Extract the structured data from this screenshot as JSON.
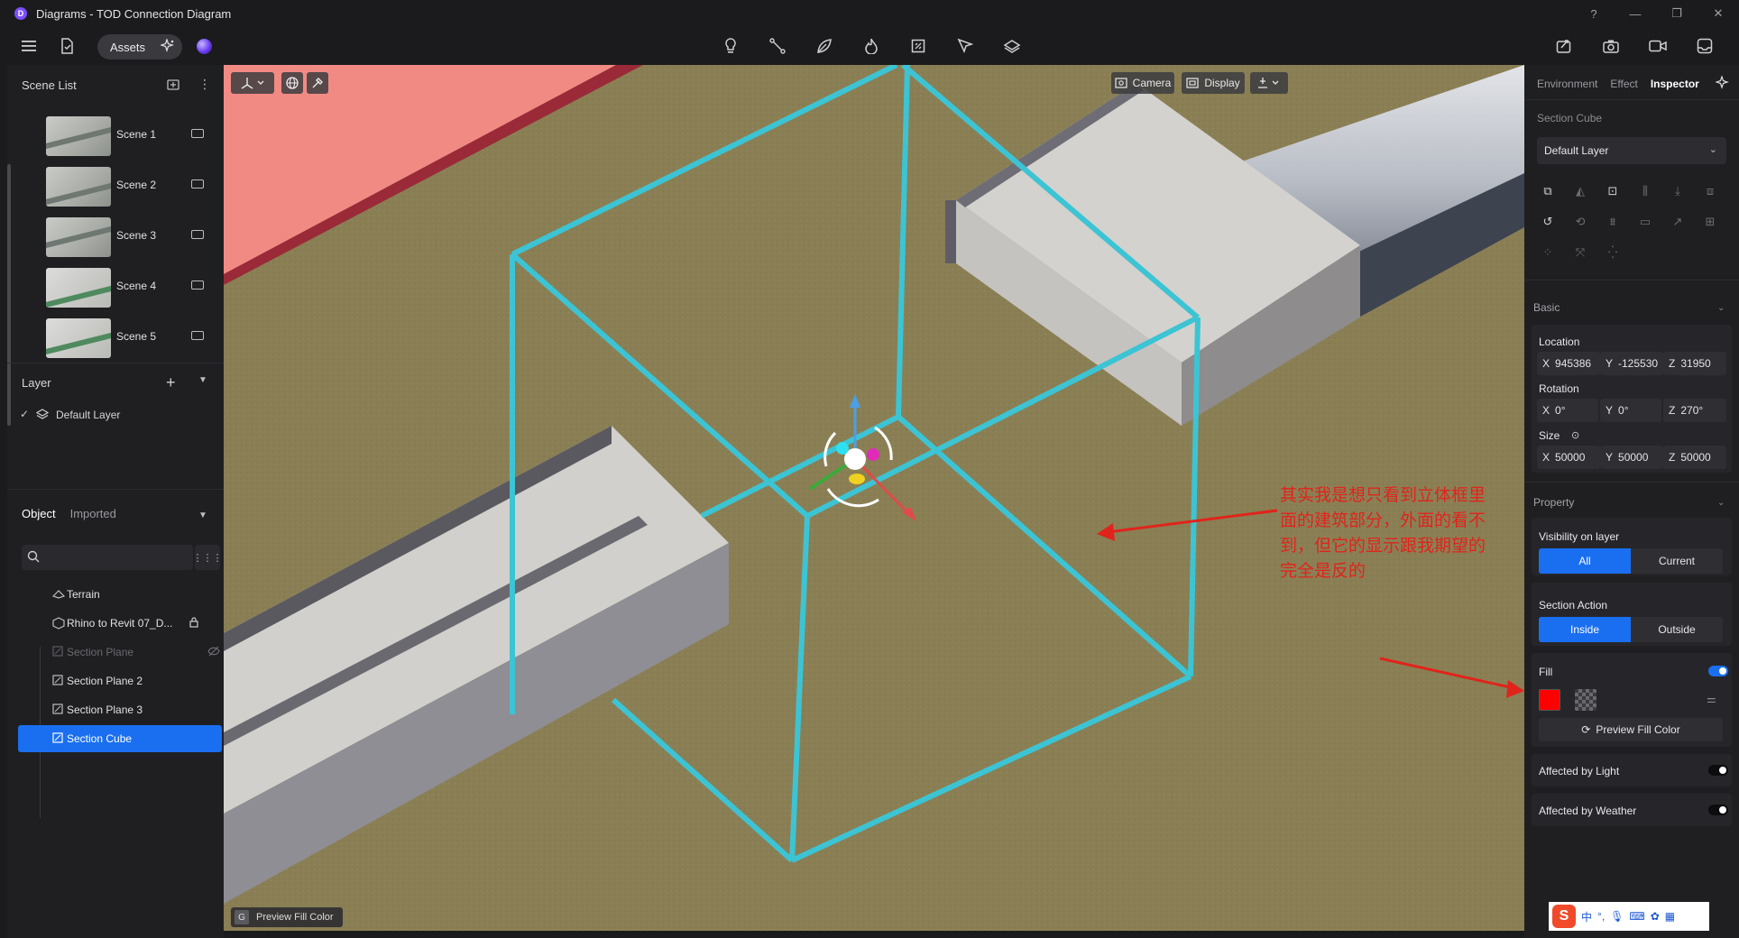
{
  "window": {
    "title": "Diagrams - TOD Connection Diagram",
    "controls": [
      "?",
      "—",
      "❐",
      "✕"
    ]
  },
  "toolbar": {
    "assets_label": "Assets",
    "center_tools": [
      "lightbulb-icon",
      "path-icon",
      "leaf-icon",
      "flame-icon",
      "section-icon",
      "pin-icon",
      "layers-icon"
    ],
    "right_tools": [
      "export-icon",
      "camera-icon",
      "video-icon",
      "inbox-icon"
    ]
  },
  "left": {
    "scene_list_title": "Scene List",
    "scenes": [
      {
        "name": "Scene 1"
      },
      {
        "name": "Scene 2"
      },
      {
        "name": "Scene 3"
      },
      {
        "name": "Scene 4"
      },
      {
        "name": "Scene 5"
      }
    ],
    "layer_title": "Layer",
    "layer_item": "Default Layer",
    "object_tab": "Object",
    "imported_tab": "Imported",
    "search_placeholder": "",
    "tree": [
      {
        "label": "Terrain",
        "icon": "terrain-icon",
        "state": "normal"
      },
      {
        "label": "Rhino to Revit 07_D...",
        "icon": "model-icon",
        "state": "locked"
      },
      {
        "label": "Section Plane",
        "icon": "section-plane-icon",
        "state": "hidden"
      },
      {
        "label": "Section Plane 2",
        "icon": "section-plane-icon",
        "state": "normal"
      },
      {
        "label": "Section Plane 3",
        "icon": "section-plane-icon",
        "state": "normal"
      },
      {
        "label": "Section Cube",
        "icon": "section-cube-icon",
        "state": "selected"
      }
    ]
  },
  "viewport": {
    "camera_label": "Camera",
    "display_label": "Display",
    "annotation": "其实我是想只看到立体框里面的建筑部分，外面的看不到，但它的显示跟我期望的完全是反的",
    "preview_key": "G",
    "preview_label": "Preview Fill Color",
    "colors": {
      "ground": "#8a7f54",
      "cube": "#3cc4d4",
      "arrow": "#e0241b",
      "red_zone": "#f28a84"
    }
  },
  "right": {
    "tabs": [
      "Environment",
      "Effect",
      "Inspector"
    ],
    "active_tab": "Inspector",
    "object_type": "Section Cube",
    "layer_dropdown": "Default Layer",
    "basic_title": "Basic",
    "location_label": "Location",
    "location": {
      "x": "945386",
      "y": "-125530",
      "z": "31950"
    },
    "rotation_label": "Rotation",
    "rotation": {
      "x": "0°",
      "y": "0°",
      "z": "270°"
    },
    "size_label": "Size",
    "size": {
      "x": "50000",
      "y": "50000",
      "z": "50000"
    },
    "property_title": "Property",
    "visibility_label": "Visibility on layer",
    "visibility_options": [
      "All",
      "Current"
    ],
    "visibility_selected": "All",
    "section_action_label": "Section Action",
    "section_action_options": [
      "Inside",
      "Outside"
    ],
    "section_action_selected": "Inside",
    "fill_label": "Fill",
    "fill_on": true,
    "fill_color": "#ff0000",
    "preview_fill_button": "Preview Fill Color",
    "affected_light_label": "Affected by Light",
    "affected_light_on": false,
    "affected_weather_label": "Affected by Weather",
    "affected_weather_on": false
  },
  "ime": {
    "logo": "S",
    "lang": "中"
  }
}
